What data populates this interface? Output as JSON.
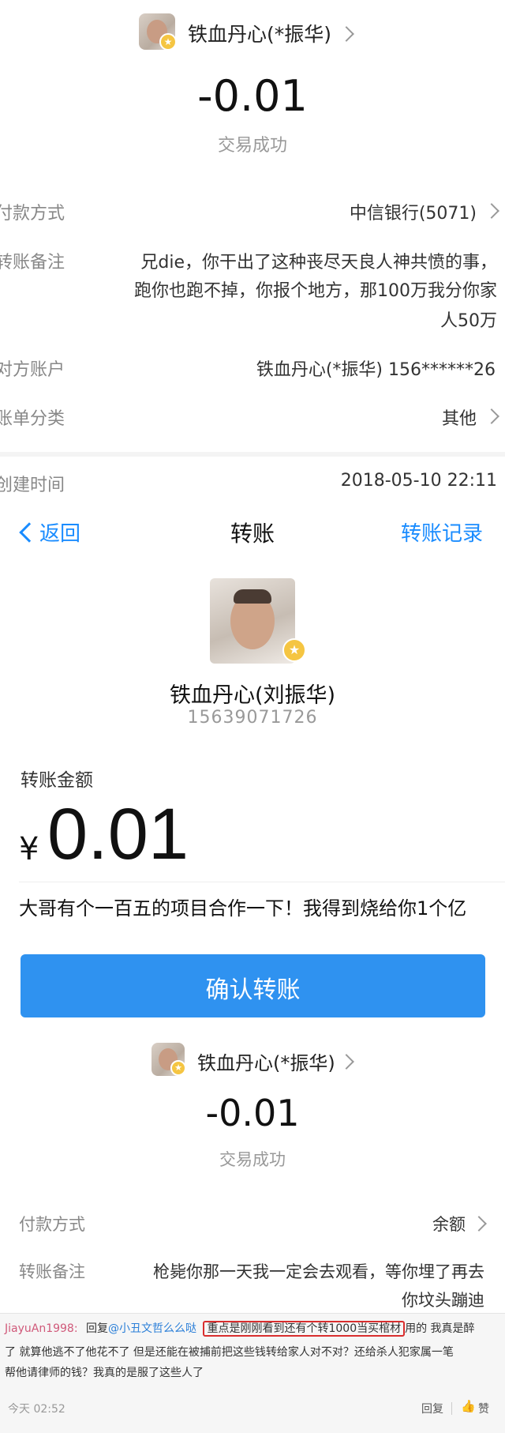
{
  "s1": {
    "name": "铁血丹心(*振华)",
    "amount": "-0.01",
    "status": "交易成功",
    "rows": [
      {
        "label": "付款方式",
        "value": "中信银行(5071)"
      },
      {
        "label": "转账备注",
        "value_lines": [
          "兄die，你干出了这种丧尽天良人神共愤的事，",
          "跑你也跑不掉，你报个地方，那100万我分你家",
          "人50万"
        ]
      },
      {
        "label": "对方账户",
        "value": "铁血丹心(*振华) 156******26"
      },
      {
        "label": "账单分类",
        "value": "其他"
      },
      {
        "label": "创建时间",
        "value": "2018-05-10 22:11"
      }
    ]
  },
  "s2": {
    "back": "返回",
    "title": "转账",
    "records": "转账记录",
    "name": "铁血丹心(刘振华)",
    "phone": "15639071726",
    "amount_label": "转账金额",
    "currency": "¥",
    "amount": "0.01",
    "note": "大哥有个一百五的项目合作一下！我得到烧给你1个亿",
    "confirm": "确认转账",
    "colors": {
      "accent": "#1a8cff",
      "button": "#2f92f0"
    }
  },
  "s3": {
    "name": "铁血丹心(*振华)",
    "amount": "-0.01",
    "status": "交易成功",
    "pay_label": "付款方式",
    "pay_value": "余额",
    "note_label": "转账备注",
    "note_lines": [
      "枪毙你那一天我一定会去观看，等你埋了再去",
      "你坟头蹦迪"
    ]
  },
  "comment": {
    "user": "JiayuAn1998:",
    "reply_prefix": "回复",
    "mention": "@小丑文哲么么哒",
    "highlight": "重点是刚刚看到还有个转1000当买棺材",
    "after_highlight": "用的 我真是醉",
    "line2": "了 就算他逃不了他花不了 但是还能在被捕前把这些钱转给家人对不对？还给杀人犯家属一笔",
    "line3": "帮他请律师的钱？我真的是服了这些人了",
    "time": "今天 02:52",
    "reply_btn": "回复",
    "like_btn": "赞"
  }
}
